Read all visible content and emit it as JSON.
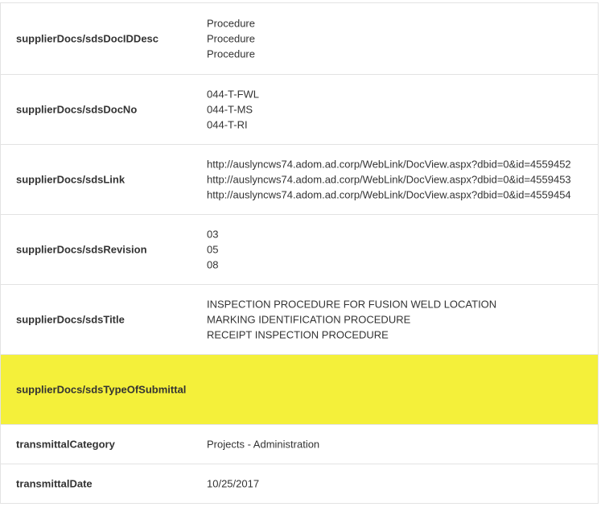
{
  "rows": [
    {
      "key": "supplierDocs/sdsDocIDDesc",
      "values": [
        "Procedure",
        "Procedure",
        "Procedure"
      ]
    },
    {
      "key": "supplierDocs/sdsDocNo",
      "values": [
        "044-T-FWL",
        "044-T-MS",
        "044-T-RI"
      ]
    },
    {
      "key": "supplierDocs/sdsLink",
      "values": [
        "http://auslyncws74.adom.ad.corp/WebLink/DocView.aspx?dbid=0&id=4559452",
        "http://auslyncws74.adom.ad.corp/WebLink/DocView.aspx?dbid=0&id=4559453",
        "http://auslyncws74.adom.ad.corp/WebLink/DocView.aspx?dbid=0&id=4559454"
      ]
    },
    {
      "key": "supplierDocs/sdsRevision",
      "values": [
        "03",
        "05",
        "08"
      ]
    },
    {
      "key": "supplierDocs/sdsTitle",
      "values": [
        "INSPECTION PROCEDURE FOR FUSION WELD LOCATION",
        "MARKING IDENTIFICATION PROCEDURE",
        "RECEIPT INSPECTION PROCEDURE"
      ]
    },
    {
      "key": "supplierDocs/sdsTypeOfSubmittal",
      "values": []
    },
    {
      "key": "transmittalCategory",
      "values": [
        "Projects - Administration"
      ]
    },
    {
      "key": "transmittalDate",
      "values": [
        "10/25/2017"
      ]
    }
  ],
  "colors": {
    "highlight": "#f4f03a",
    "border": "#e3e3e3",
    "text": "#333333"
  }
}
